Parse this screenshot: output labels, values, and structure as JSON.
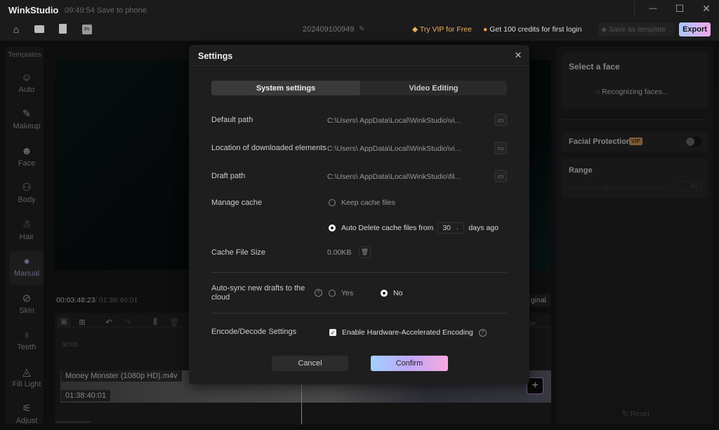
{
  "app": {
    "name": "WinkStudio",
    "status": "09:49:54 Save to phone",
    "project": "202409100949"
  },
  "toolbar": {
    "vip": "Try VIP for Free",
    "credits": "Get 100 credits for first login",
    "save_template": "Save as template",
    "export": "Export",
    "pr": "Pr"
  },
  "sidebar": {
    "header": "Templates",
    "items": [
      {
        "label": "Auto",
        "icon": "face-icon"
      },
      {
        "label": "Makeup",
        "icon": "makeup-icon"
      },
      {
        "label": "Face",
        "icon": "face-shape-icon"
      },
      {
        "label": "Body",
        "icon": "body-icon"
      },
      {
        "label": "Hair",
        "icon": "hair-icon"
      },
      {
        "label": "Manual",
        "icon": "manual-icon",
        "active": true
      },
      {
        "label": "Skin",
        "icon": "skin-icon"
      },
      {
        "label": "Teeth",
        "icon": "teeth-icon"
      },
      {
        "label": "Fill Light",
        "icon": "light-icon"
      },
      {
        "label": "Adjust",
        "icon": "adjust-icon"
      }
    ]
  },
  "player": {
    "current": "00:03:48:23",
    "total": "/ 01:38:40:01",
    "original": "ginal"
  },
  "timeline": {
    "ruler_start": "00:00",
    "clip_name": "Money Monster (1080p HD).m4v",
    "clip_duration": "01:38:40:01",
    "collapse": "pse"
  },
  "right_panel": {
    "select_face": "Select a face",
    "recognizing": "Recognizing faces...",
    "facial_protection": "Facial Protection",
    "vip_badge": "VIP",
    "protection_on": false,
    "range_label": "Range",
    "range_value": "50",
    "reset": "Reset"
  },
  "settings": {
    "title": "Settings",
    "tabs": [
      {
        "label": "System settings",
        "active": true
      },
      {
        "label": "Video Editing",
        "active": false
      }
    ],
    "default_path": {
      "label": "Default path",
      "value": "C:\\Users\\        AppData\\Local\\WinkStudio\\vi..."
    },
    "downloads_path": {
      "label": "Location of downloaded elements",
      "value": "C:\\Users\\        AppData\\Local\\WinkStudio\\vi..."
    },
    "draft_path": {
      "label": "Draft path",
      "value": "C:\\Users\\        AppData\\Local\\WinkStudio\\fil..."
    },
    "cache": {
      "label": "Manage cache",
      "keep": "Keep cache files",
      "auto_delete": "Auto Delete cache files from",
      "days": "30",
      "days_suffix": "days ago",
      "selected": "auto_delete"
    },
    "cache_size": {
      "label": "Cache File Size",
      "value": "0.00KB"
    },
    "sync": {
      "label": "Auto-sync new drafts to the cloud",
      "yes": "Yes",
      "no": "No",
      "selected": "no"
    },
    "encode": {
      "label": "Encode/Decode Settings",
      "option": "Enable Hardware-Accelerated Encoding",
      "checked": true
    },
    "cancel": "Cancel",
    "confirm": "Confirm"
  }
}
